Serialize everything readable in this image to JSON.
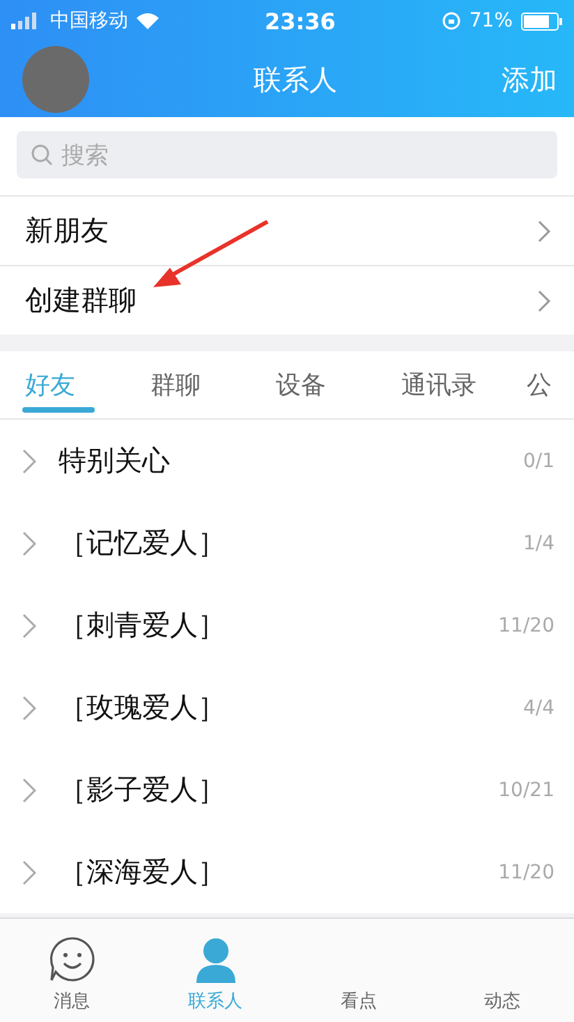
{
  "status_bar": {
    "carrier": "中国移动",
    "time": "23:36",
    "battery": "71%"
  },
  "header": {
    "title": "联系人",
    "action": "添加"
  },
  "search": {
    "placeholder": "搜索"
  },
  "entries": [
    {
      "label": "新朋友"
    },
    {
      "label": "创建群聊"
    }
  ],
  "tabs": [
    {
      "label": "好友",
      "selected": true
    },
    {
      "label": "群聊",
      "selected": false
    },
    {
      "label": "设备",
      "selected": false
    },
    {
      "label": "通讯录",
      "selected": false
    },
    {
      "label": "公",
      "selected": false
    }
  ],
  "groups": [
    {
      "name": "特别关心",
      "count": "0/1"
    },
    {
      "name": "［记忆爱人］",
      "count": "1/4"
    },
    {
      "name": "［刺青爱人］",
      "count": "11/20"
    },
    {
      "name": "［玫瑰爱人］",
      "count": "4/4"
    },
    {
      "name": "［影子爱人］",
      "count": "10/21"
    },
    {
      "name": "［深海爱人］",
      "count": "11/20"
    }
  ],
  "bottom_tabs": [
    {
      "label": "消息",
      "kind": "smile",
      "selected": false
    },
    {
      "label": "联系人",
      "kind": "person",
      "selected": true
    },
    {
      "label": "看点",
      "kind": "none",
      "selected": false
    },
    {
      "label": "动态",
      "kind": "none",
      "selected": false
    }
  ]
}
